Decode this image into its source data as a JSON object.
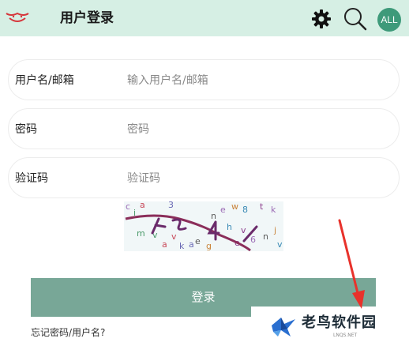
{
  "header": {
    "title": "用户登录",
    "avatar_text": "ALL",
    "logo_color": "#d6363b",
    "background": "#d6efe4"
  },
  "form": {
    "username": {
      "label": "用户名/邮箱",
      "placeholder": "输入用户名/邮箱",
      "value": ""
    },
    "password": {
      "label": "密码",
      "placeholder": "密码",
      "value": ""
    },
    "captcha": {
      "label": "验证码",
      "placeholder": "验证码",
      "value": ""
    }
  },
  "captcha_image": {
    "glyphs": [
      "c",
      "i",
      "a",
      "3",
      "n",
      "w",
      "8",
      "t",
      "k",
      "v",
      "a",
      "k",
      "e",
      "g",
      "h",
      "v",
      "6",
      "m",
      "v",
      "a",
      "n",
      "j",
      "v",
      "e",
      "e"
    ]
  },
  "login_button": {
    "label": "登录",
    "color": "#78a797"
  },
  "forgot_link": "忘记密码/用户名?",
  "watermark": {
    "name": "老鸟软件园",
    "domain": "LNQS.NET"
  },
  "icons": [
    "logo-icon",
    "gear-icon",
    "search-icon",
    "bird-logo-icon",
    "arrow-annotation"
  ]
}
